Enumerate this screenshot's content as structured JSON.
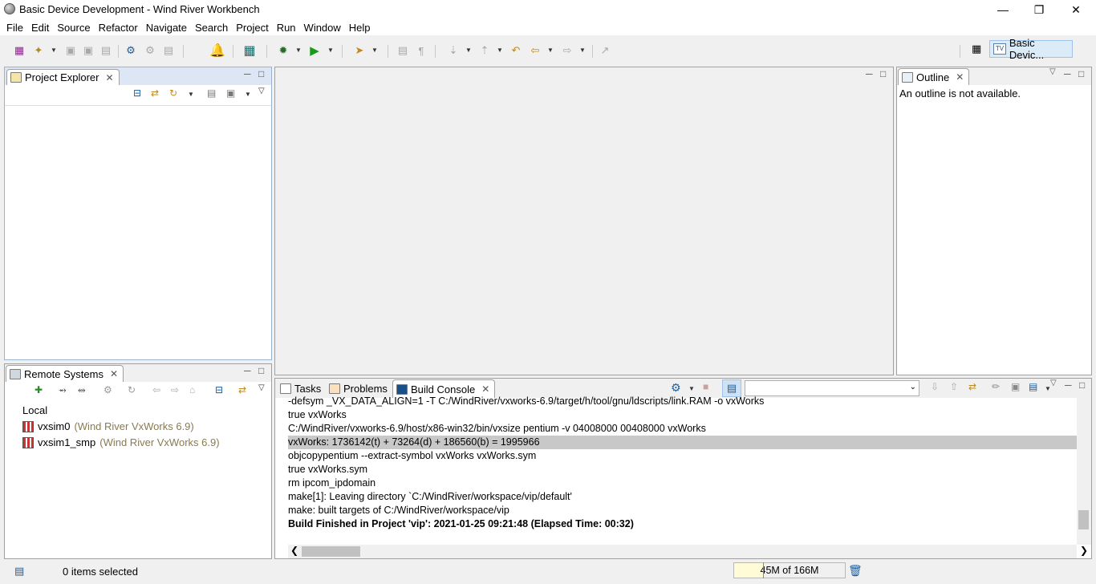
{
  "window": {
    "title": "Basic Device Development - Wind River Workbench",
    "minimize": "—",
    "restore": "❐",
    "close": "✕"
  },
  "menu": [
    "File",
    "Edit",
    "Source",
    "Refactor",
    "Navigate",
    "Search",
    "Project",
    "Run",
    "Window",
    "Help"
  ],
  "perspective": {
    "label": "Basic Devic..."
  },
  "project_explorer": {
    "title": "Project Explorer"
  },
  "outline": {
    "title": "Outline",
    "message": "An outline is not available."
  },
  "remote_systems": {
    "title": "Remote Systems",
    "items": [
      {
        "label": "Local",
        "sub": ""
      },
      {
        "label": "vxsim0",
        "sub": "(Wind River VxWorks 6.9)"
      },
      {
        "label": "vxsim1_smp",
        "sub": "(Wind River VxWorks 6.9)"
      }
    ]
  },
  "bottom_tabs": {
    "tasks": "Tasks",
    "problems": "Problems",
    "build_console": "Build Console"
  },
  "console": {
    "lines": [
      "    -defsym _VX_DATA_ALIGN=1 -T C:/WindRiver/vxworks-6.9/target/h/tool/gnu/ldscripts/link.RAM -o vxWorks",
      "true  vxWorks",
      "C:/WindRiver/vxworks-6.9/host/x86-win32/bin/vxsize pentium -v 04008000 00408000 vxWorks",
      "vxWorks: 1736142(t) + 73264(d) +  186560(b) = 1995966",
      "objcopypentium --extract-symbol vxWorks vxWorks.sym",
      "true vxWorks.sym",
      "rm ipcom_ipdomain",
      "make[1]: Leaving directory `C:/WindRiver/workspace/vip/default'",
      "make: built targets of C:/WindRiver/workspace/vip",
      "Build Finished in Project 'vip':   2021-01-25 09:21:48   (Elapsed Time: 00:32)"
    ]
  },
  "status": {
    "selection": "0 items selected",
    "heap": "45M of 166M",
    "heap_used_fraction": 0.27
  }
}
